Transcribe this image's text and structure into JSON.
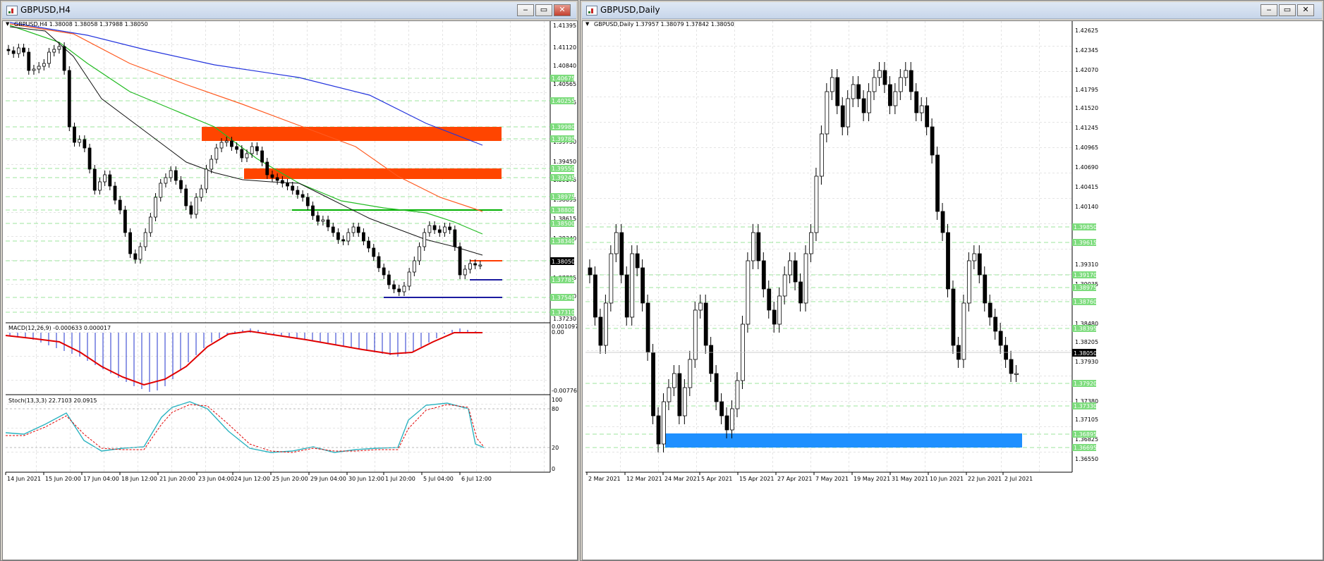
{
  "left_window": {
    "title": "GBPUSD,H4",
    "buttons": {
      "minimize": "‒",
      "restore": "▭",
      "close": "✕"
    },
    "info_line": "GBPUSD,H4  1.38008 1.38058 1.37988 1.38050",
    "price_ticks": [
      "1.41395",
      "1.41120",
      "1.40840",
      "1.40565",
      "1.40285",
      "1.39730",
      "1.39450",
      "1.39175",
      "1.38895",
      "1.38615",
      "1.38340",
      "1.37785",
      "1.37510",
      "1.37230"
    ],
    "level_labels": [
      "1.40675",
      "1.40255",
      "1.39980",
      "1.39780",
      "1.39550",
      "1.39245",
      "1.38975",
      "1.38800",
      "1.38500",
      "1.38340",
      "1.38050",
      "1.37785",
      "1.37540",
      "1.37310"
    ],
    "current_price": "1.38050",
    "macd_label": "MACD(12,26,9) -0.000633 0.000017",
    "macd_ticks": [
      "0.001097",
      "0.00",
      "-0.007767"
    ],
    "stoch_label": "Stoch(13,3,3) 22.7103 20.0915",
    "stoch_ticks": [
      "100",
      "80",
      "20",
      "0"
    ],
    "time_labels": [
      "14 Jun 2021",
      "15 Jun 20:00",
      "17 Jun 04:00",
      "18 Jun 12:00",
      "21 Jun 20:00",
      "23 Jun 04:00",
      "24 Jun 12:00",
      "25 Jun 20:00",
      "29 Jun 04:00",
      "30 Jun 12:00",
      "1 Jul 20:00",
      "5 Jul 04:00",
      "6 Jul 12:00"
    ],
    "colors": {
      "zone": "#ff4500",
      "green_line": "#00b000",
      "blue_line": "#1a1aa0",
      "red_line": "#ff3b00",
      "ma_blue": "#2233dd",
      "ma_red": "#ff5a20",
      "ma_green": "#22bb22",
      "ma_black": "#111111"
    }
  },
  "right_window": {
    "title": "GBPUSD,Daily",
    "buttons": {
      "minimize": "‒",
      "restore": "▭",
      "close": "✕"
    },
    "info_line": "GBPUSD,Daily  1.37957 1.38079 1.37842 1.38050",
    "price_ticks": [
      "1.42625",
      "1.42345",
      "1.42070",
      "1.41795",
      "1.41520",
      "1.41245",
      "1.40965",
      "1.40690",
      "1.40415",
      "1.40140",
      "1.39310",
      "1.39035",
      "1.38480",
      "1.38205",
      "1.37930",
      "1.37380",
      "1.37105",
      "1.36825",
      "1.36550"
    ],
    "level_labels": [
      "1.39850",
      "1.39615",
      "1.39170",
      "1.38975",
      "1.38760",
      "1.38395",
      "1.37920",
      "1.37330",
      "1.36895",
      "1.36695"
    ],
    "current_price": "1.38050",
    "time_labels": [
      "2 Mar 2021",
      "12 Mar 2021",
      "24 Mar 2021",
      "5 Apr 2021",
      "15 Apr 2021",
      "27 Apr 2021",
      "7 May 2021",
      "19 May 2021",
      "31 May 2021",
      "10 Jun 2021",
      "22 Jun 2021",
      "2 Jul 2021"
    ],
    "colors": {
      "zone": "#1e90ff"
    }
  }
}
